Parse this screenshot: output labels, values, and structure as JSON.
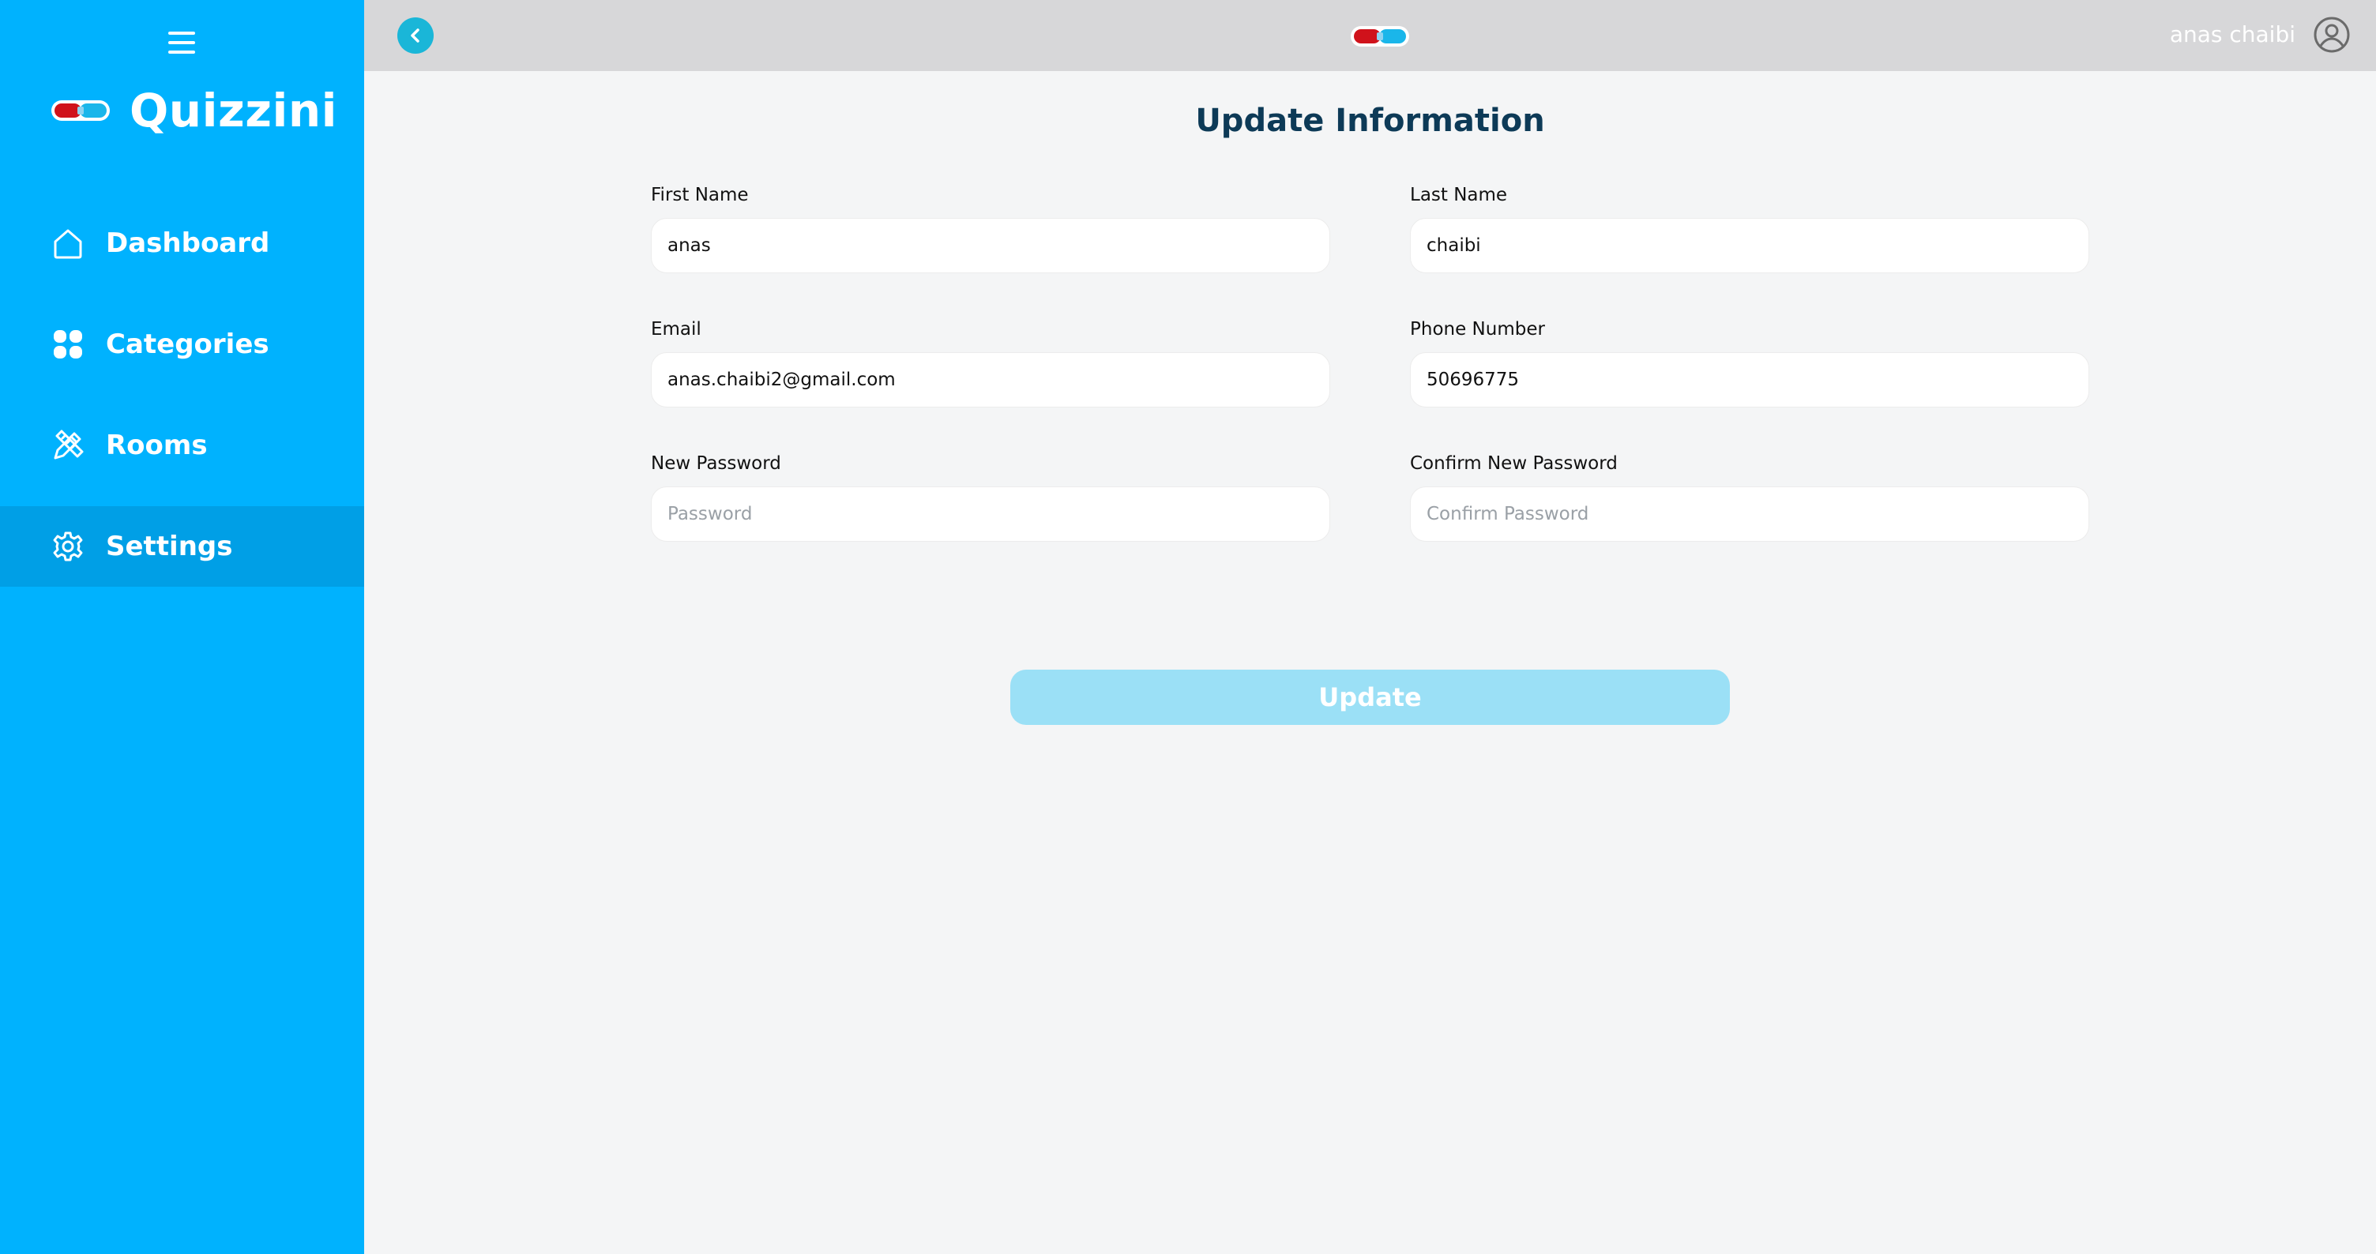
{
  "app": {
    "name": "Quizzini",
    "brand_color": "#00b2fe",
    "logo_icon": "pill-logo-icon"
  },
  "sidebar": {
    "menu_icon": "hamburger-menu-icon",
    "items": [
      {
        "label": "Dashboard",
        "icon": "home-icon",
        "active": false
      },
      {
        "label": "Categories",
        "icon": "grid-dots-icon",
        "active": false
      },
      {
        "label": "Rooms",
        "icon": "pencil-ruler-icon",
        "active": false
      },
      {
        "label": "Settings",
        "icon": "gear-icon",
        "active": true
      }
    ]
  },
  "header": {
    "back_icon": "chevron-left-icon",
    "user_name": "anas chaibi",
    "avatar_icon": "user-circle-icon"
  },
  "form": {
    "title": "Update Information",
    "first_name": {
      "label": "First Name",
      "value": "anas",
      "placeholder": ""
    },
    "last_name": {
      "label": "Last Name",
      "value": "chaibi",
      "placeholder": ""
    },
    "email": {
      "label": "Email",
      "value": "anas.chaibi2@gmail.com",
      "placeholder": ""
    },
    "phone": {
      "label": "Phone Number",
      "value": "50696775",
      "placeholder": ""
    },
    "new_password": {
      "label": "New Password",
      "value": "",
      "placeholder": "Password"
    },
    "confirm_password": {
      "label": "Confirm New Password",
      "value": "",
      "placeholder": "Confirm Password"
    },
    "submit_label": "Update",
    "submit_color": "#9be0f6"
  }
}
